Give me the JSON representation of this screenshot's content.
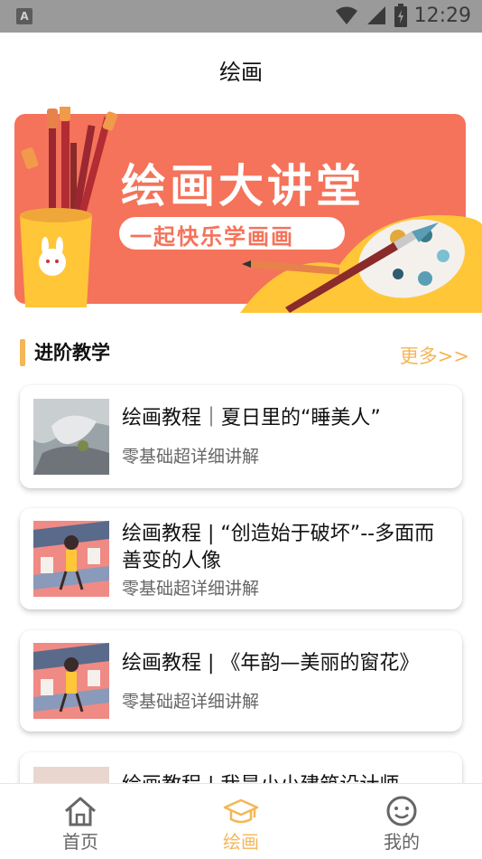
{
  "status_bar": {
    "time": "12:29",
    "left_icon": "A",
    "icons": [
      "wifi-icon",
      "signal-icon",
      "battery-icon"
    ]
  },
  "header": {
    "title": "绘画"
  },
  "banner": {
    "title": "绘画大讲堂",
    "subtitle": "一起快乐学画画"
  },
  "section": {
    "title": "进阶教学",
    "more": "更多>>"
  },
  "cards": [
    {
      "title": "绘画教程｜夏日里的“睡美人”",
      "subtitle": "零基础超详细讲解"
    },
    {
      "title": "绘画教程 | “创造始于破坏”--多面而善变的人像",
      "subtitle": "零基础超详细讲解"
    },
    {
      "title": "绘画教程 | 《年韵—美丽的窗花》",
      "subtitle": "零基础超详细讲解"
    },
    {
      "title": "绘画教程 | 我是小小建筑设计师",
      "subtitle": ""
    }
  ],
  "nav": {
    "items": [
      {
        "label": "首页",
        "icon": "home-icon",
        "active": false
      },
      {
        "label": "绘画",
        "icon": "graduation-cap-icon",
        "active": true
      },
      {
        "label": "我的",
        "icon": "smiley-icon",
        "active": false
      }
    ]
  },
  "colors": {
    "accent": "#f5b656",
    "banner": "#f4735a",
    "inactive": "#666666"
  }
}
